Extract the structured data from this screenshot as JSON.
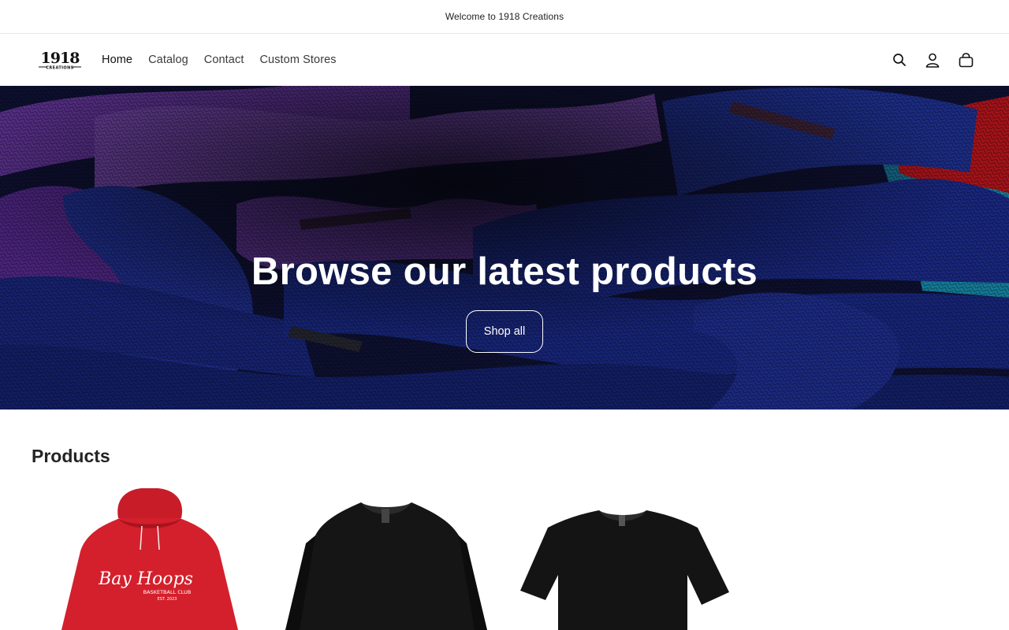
{
  "announcement": {
    "text": "Welcome to 1918 Creations"
  },
  "header": {
    "logo": {
      "main": "1918",
      "sub": "CREATIONS"
    },
    "nav": [
      {
        "label": "Home"
      },
      {
        "label": "Catalog"
      },
      {
        "label": "Contact"
      },
      {
        "label": "Custom Stores"
      }
    ],
    "icons": [
      "search-icon",
      "account-icon",
      "cart-icon"
    ]
  },
  "hero": {
    "title": "Browse our latest products",
    "button_label": "Shop all"
  },
  "products": {
    "title": "Products",
    "items": [
      {
        "name": "red-hoodie",
        "print_script": "Bay Hoops",
        "print_line1": "BASKETBALL CLUB",
        "print_line2": "EST. 2023"
      },
      {
        "name": "black-long-sleeve-tee"
      },
      {
        "name": "black-tee"
      }
    ]
  },
  "colors": {
    "hoodie": "#d4202c",
    "shirt": "#141414",
    "hero_blue": "#1f2f86",
    "hero_purple": "#6a3aa2"
  }
}
